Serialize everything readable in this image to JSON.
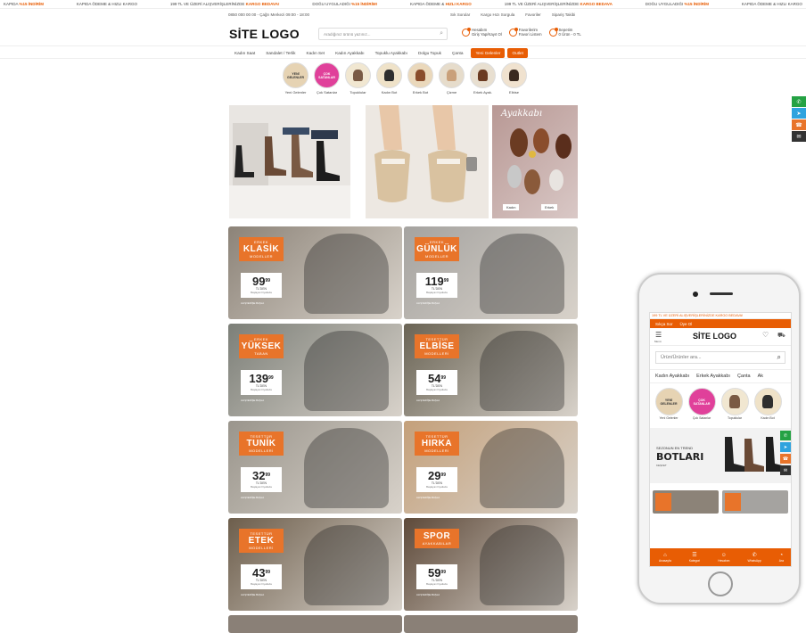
{
  "topbar": [
    {
      "pre": "KAPIDA ",
      "b": "%15 İNDİRİM"
    },
    {
      "pre": "KAPIDA ÖDEME & HIZLI KARGO",
      "b": ""
    },
    {
      "pre": "199 TL VE ÜZERİ ALIŞVERİŞLERİNİZDE ",
      "b": "KARGO BEDAVA!"
    },
    {
      "pre": "DOĞU UYGULADIĞI ",
      "b": "%15 İNDİRİM!"
    },
    {
      "pre": "KAPIDA ÖDEME & ",
      "b": "HIZLI KARGO"
    },
    {
      "pre": "199 TL VE ÜZERİ ALIŞVERİŞLERİNİZDE ",
      "b": "KARGO BEDAVA"
    },
    {
      "pre": "DOĞU UYGULADIĞI ",
      "b": "%15 İNDİRİM"
    },
    {
      "pre": "KAPIDA ÖDEME & HIZLI KARGO",
      "b": ""
    }
  ],
  "info": {
    "phone": "0850 000 00 00 - Çağrı Merkezi 09:00 - 18:00",
    "links": [
      "Sık Sorular",
      "Kargo Hızı Sorgula",
      "Favoriler",
      "Sipariş Takibi"
    ]
  },
  "header": {
    "logo": "SİTE LOGO",
    "search_placeholder": "Aradığınız ürünü yazınız...",
    "links": [
      {
        "l1": "Hesabım",
        "l2": "Giriş Yap/Kayıt Ol"
      },
      {
        "l1": "Favorilerim",
        "l2": "Favori Listem"
      },
      {
        "l1": "Sepetim",
        "l2": "0 Ürün - 0 TL"
      }
    ]
  },
  "nav": {
    "items": [
      "Kadın Saat",
      "Sandalet / Terlik",
      "Kadın Set",
      "Kadın Ayakkabı",
      "Topuklu Ayakkabı",
      "Dolgu Topuk",
      "Çanta"
    ],
    "btn1": "Yeni Gelenler",
    "btn2": "Outlet"
  },
  "circles": [
    {
      "label": "Yeni Gelenler",
      "badge": "YENİ GELENLER",
      "badge_color": "#e6d3b3",
      "text_color": "#333"
    },
    {
      "label": "Çok Satanlar",
      "badge": "ÇOK SATANLAR",
      "badge_color": "#e0409a",
      "text_color": "#fff"
    },
    {
      "label": "Topuklular",
      "badge": "",
      "badge_color": "#f1e7d1",
      "text_color": "#333"
    },
    {
      "label": "Kadın Bot",
      "badge": "",
      "badge_color": "#efe2c8",
      "text_color": "#333"
    },
    {
      "label": "Erkek Bot",
      "badge": "",
      "badge_color": "#ead8bb",
      "text_color": "#333"
    },
    {
      "label": "Çizme",
      "badge": "",
      "badge_color": "#e6dccb",
      "text_color": "#333"
    },
    {
      "label": "Erkek Ayak.",
      "badge": "",
      "badge_color": "#e8dfd0",
      "text_color": "#333"
    },
    {
      "label": "Elbise",
      "badge": "",
      "badge_color": "#f0e2cf",
      "text_color": "#333"
    }
  ],
  "banners": {
    "b3_title": "Ayakkabı",
    "b3_btn1": "Kadın",
    "b3_btn2": "Erkek"
  },
  "tiles": [
    {
      "t1": "ERKEK",
      "t2": "KLASİK",
      "t3": "MODELLER",
      "price": "99",
      "cents": "99",
      "bg": "#8c8378"
    },
    {
      "t1": "ERKEK",
      "t2": "GÜNLÜK",
      "t3": "MODELLER",
      "price": "119",
      "cents": "99",
      "bg": "#a5a3a0"
    },
    {
      "t1": "ERKEK",
      "t2": "YÜKSEK",
      "t3": "TABAN",
      "price": "139",
      "cents": "99",
      "bg": "#7c7f78"
    },
    {
      "t1": "TESETTÜR",
      "t2": "ELBİSE",
      "t3": "MODELLERİ",
      "price": "54",
      "cents": "99",
      "bg": "#6a6455"
    },
    {
      "t1": "TESETTÜR",
      "t2": "TUNİK",
      "t3": "MODELLERİ",
      "price": "32",
      "cents": "99",
      "bg": "#9a958c"
    },
    {
      "t1": "TESETTÜR",
      "t2": "HIRKA",
      "t3": "MODELLERİ",
      "price": "29",
      "cents": "99",
      "bg": "#c4a07a"
    },
    {
      "t1": "TESETTÜR",
      "t2": "ETEK",
      "t3": "MODELLERİ",
      "price": "43",
      "cents": "99",
      "bg": "#6d5e4c"
    },
    {
      "t1": "",
      "t2": "SPOR",
      "t3": "AYAKKABILAR",
      "price": "59",
      "cents": "99",
      "bg": "#5e4a3a"
    }
  ],
  "tile_currency": "TL'DEN",
  "tile_note": "Başlayan Fiyatlarla",
  "tile_more": "ALIŞVERİŞE BAŞLA",
  "side": [
    {
      "icon": "✆",
      "color": "#25a244"
    },
    {
      "icon": "➤",
      "color": "#2fa3de"
    },
    {
      "icon": "☎",
      "color": "#e8742a"
    },
    {
      "icon": "✉",
      "color": "#333"
    }
  ],
  "mobile": {
    "topline": "199 TL VE ÜZERİ ALIŞVERİŞLERİNİZDE KARGO BEDAVA!",
    "bar": [
      "Sıkça Sor",
      "Üye Ol"
    ],
    "logo": "SİTE LOGO",
    "menu_label": "Menü",
    "search": "Ürün/Ürünler ara...",
    "cats": [
      "Kadın Ayakkabı",
      "Erkek Ayakkabı",
      "Çanta",
      "Ak"
    ],
    "circles": [
      {
        "label": "Yeni Gelenler",
        "badge": "YENİ GELENLER",
        "badge_color": "#e6d3b3",
        "text_color": "#333"
      },
      {
        "label": "Çok Satanlar",
        "badge": "ÇOK SATANLAR",
        "badge_color": "#e0409a",
        "text_color": "#fff"
      },
      {
        "label": "Topuklular",
        "badge": "",
        "badge_color": "#f1e7d1",
        "text_color": "#333"
      },
      {
        "label": "Kadın Bot",
        "badge": "",
        "badge_color": "#efe2c8",
        "text_color": "#333"
      }
    ],
    "banner": {
      "s1": "SEZONUN EN TREND",
      "s2": "BOTLARI",
      "s3": "KEŞFET"
    },
    "nav": [
      {
        "i": "⌂",
        "l": "Anasayfa"
      },
      {
        "i": "☰",
        "l": "Kategori"
      },
      {
        "i": "☺",
        "l": "Hesabım"
      },
      {
        "i": "✆",
        "l": "WhatsApp"
      },
      {
        "i": "◔",
        "l": "Ara"
      }
    ]
  },
  "accent": "#e85d04"
}
